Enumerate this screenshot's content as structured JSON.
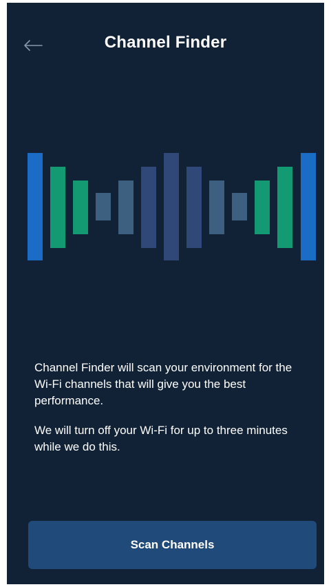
{
  "header": {
    "title": "Channel Finder",
    "back_icon": "arrow-left-icon"
  },
  "illustration": {
    "name": "signal-bars-illustration",
    "colors": {
      "blue": "#1a6cc4",
      "green": "#149a73",
      "slate": "#3e6080",
      "indigo": "#2f4878"
    }
  },
  "body": {
    "paragraph1": "Channel Finder will scan your environment for the Wi-Fi channels that will give you the best performance.",
    "paragraph2": "We will turn off your Wi-Fi for up to three minutes while we do this."
  },
  "actions": {
    "scan_label": "Scan Channels"
  },
  "colors": {
    "background": "#112236",
    "button": "#1f4a7a",
    "text": "#ffffff"
  }
}
